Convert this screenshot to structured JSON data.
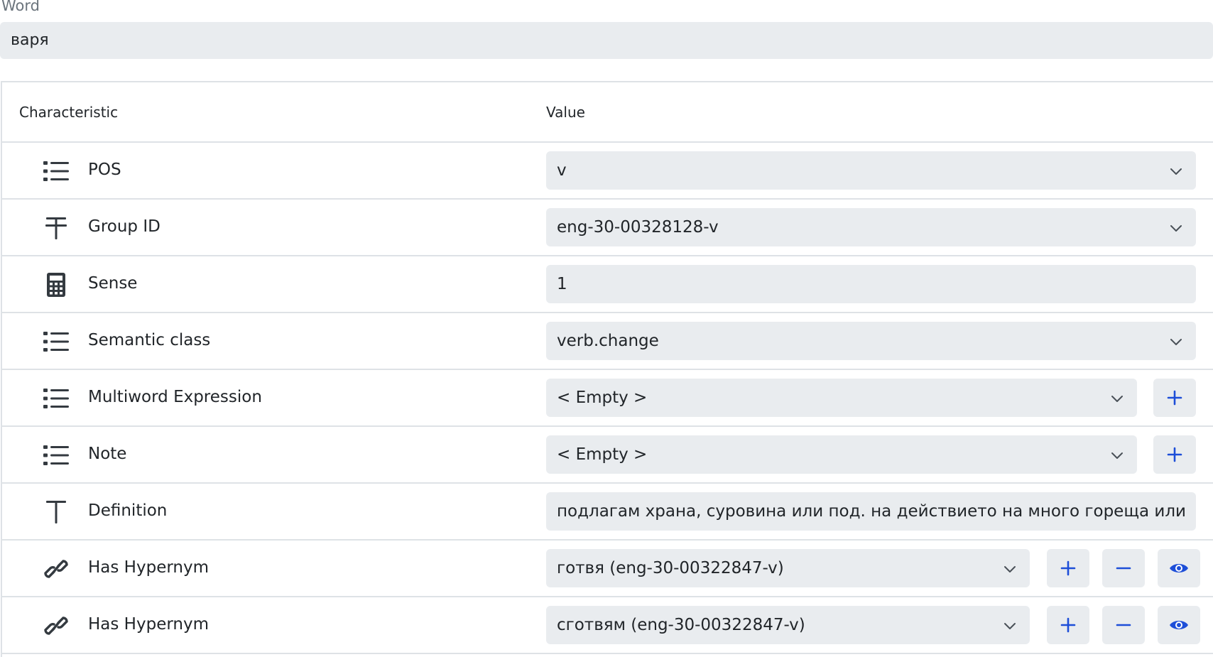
{
  "word": {
    "label": "Word",
    "value": "варя"
  },
  "table": {
    "headers": {
      "characteristic": "Characteristic",
      "value": "Value"
    },
    "rows": [
      {
        "label": "POS",
        "icon": "list-icon",
        "control": "select",
        "value": "v"
      },
      {
        "label": "Group ID",
        "icon": "text-strike-icon",
        "control": "select",
        "value": "eng-30-00328128-v"
      },
      {
        "label": "Sense",
        "icon": "calculator-icon",
        "control": "input",
        "value": "1"
      },
      {
        "label": "Semantic class",
        "icon": "list-icon",
        "control": "select",
        "value": "verb.change"
      },
      {
        "label": "Multiword Expression",
        "icon": "list-icon",
        "control": "select",
        "value": "< Empty >",
        "buttons": [
          "plus"
        ]
      },
      {
        "label": "Note",
        "icon": "list-icon",
        "control": "select",
        "value": "< Empty >",
        "buttons": [
          "plus"
        ]
      },
      {
        "label": "Definition",
        "icon": "text-icon",
        "control": "input",
        "value": "подлагам храна, суровина или под. на действието на много гореща или в"
      },
      {
        "label": "Has Hypernym",
        "icon": "link-icon",
        "control": "select",
        "value": "готвя (eng-30-00322847-v)",
        "buttons": [
          "plus",
          "minus",
          "view"
        ]
      },
      {
        "label": "Has Hypernym",
        "icon": "link-icon",
        "control": "select",
        "value": "сготвям (eng-30-00322847-v)",
        "buttons": [
          "plus",
          "minus",
          "view"
        ]
      }
    ]
  },
  "colors": {
    "accent": "#1d4ed8",
    "field_bg": "#e9ecef",
    "border": "#dee2e6",
    "icon": "#343a40"
  }
}
